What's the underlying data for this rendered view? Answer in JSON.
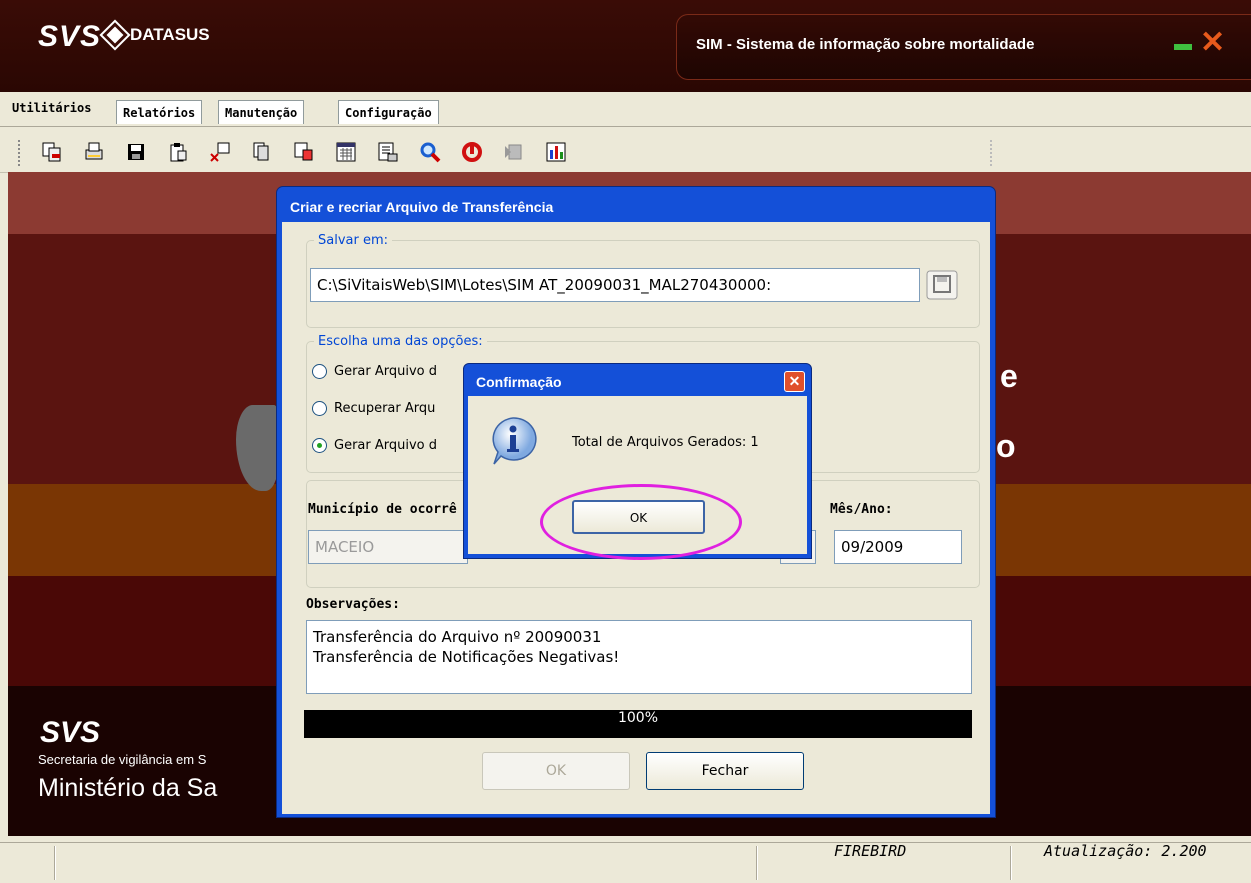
{
  "window": {
    "logo_svs": "SVS",
    "logo_datasus": "DATASUS",
    "title": "SIM - Sistema de informação sobre mortalidade",
    "close_glyph": "✕"
  },
  "tabs": [
    {
      "label": "Utilitários",
      "active": true
    },
    {
      "label": "Relatórios",
      "active": false
    },
    {
      "label": "Manutenção",
      "active": false
    },
    {
      "label": "Configuração",
      "active": false
    }
  ],
  "toolbar": {
    "icons": [
      "copy-icon",
      "print-icon",
      "save-icon",
      "clipboard-icon",
      "cut-icon",
      "pages-icon",
      "paste-icon",
      "calendar-icon",
      "list-icon",
      "search-icon",
      "refresh-icon",
      "move-icon",
      "chart-icon"
    ]
  },
  "background": {
    "svs": "SVS",
    "secretaria": "Secretaria de vigilância em S",
    "ministerio": "Ministério da Sa",
    "letter_e": "e",
    "letter_o": "o"
  },
  "dialog": {
    "title": "Criar e recriar Arquivo de Transferência",
    "save_legend": "Salvar em:",
    "save_path": "C:\\SiVitaisWeb\\SIM\\Lotes\\SIM AT_20090031_MAL270430000:",
    "options_legend": "Escolha uma das opções:",
    "options": [
      {
        "label": "Gerar Arquivo d",
        "selected": false
      },
      {
        "label": "Recuperar Arqu",
        "selected": false
      },
      {
        "label": "Gerar Arquivo d",
        "selected": true
      }
    ],
    "municipio_label": "Município de ocorrê",
    "municipio_value": "MACEIO",
    "mes_ano_label": "Mês/Ano:",
    "mes_ano_value": "09/2009",
    "obs_label": "Observações:",
    "obs_line1": "Transferência do Arquivo nº 20090031",
    "obs_line2": "Transferência de Notificações Negativas!",
    "progress": "100%",
    "progress_fraction": 1.0,
    "ok_label": "OK",
    "fechar_label": "Fechar"
  },
  "confirm": {
    "title": "Confirmação",
    "message": "Total de Arquivos Gerados: 1",
    "ok_label": "OK"
  },
  "status": {
    "db": "FIREBIRD",
    "update": "Atualização: 2.200"
  },
  "colors": {
    "title_bg": "#2a0703",
    "dialog_frame": "#1450d8",
    "band_red": "#8c3a32",
    "band_dark": "#5a1410",
    "band_orange": "#7a3604",
    "highlight": "#e020e0"
  }
}
